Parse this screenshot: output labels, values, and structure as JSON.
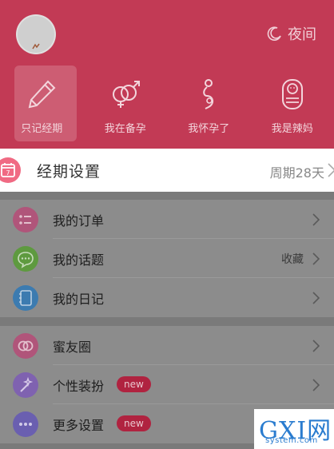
{
  "header": {
    "night_label": "夜间",
    "night_icon": "moon-icon",
    "modes": [
      {
        "label": "只记经期",
        "icon": "pen-icon",
        "active": true
      },
      {
        "label": "我在备孕",
        "icon": "gender-rings-icon",
        "active": false
      },
      {
        "label": "我怀孕了",
        "icon": "pregnant-icon",
        "active": false
      },
      {
        "label": "我是辣妈",
        "icon": "baby-icon",
        "active": false
      }
    ]
  },
  "period": {
    "title": "经期设置",
    "value": "周期28天",
    "icon": "calendar-icon",
    "calendar_day": "7"
  },
  "menu": {
    "orders": {
      "label": "我的订单",
      "icon": "list-icon"
    },
    "topics": {
      "label": "我的话题",
      "right": "收藏",
      "icon": "chat-bubble-icon"
    },
    "diary": {
      "label": "我的日记",
      "icon": "notebook-icon"
    },
    "friends": {
      "label": "蜜友圈",
      "icon": "heart-rings-icon"
    },
    "dressup": {
      "label": "个性装扮",
      "badge": "new",
      "icon": "magic-wand-icon"
    },
    "more": {
      "label": "更多设置",
      "badge": "new",
      "icon": "more-dots-icon"
    }
  },
  "watermark": {
    "main": "GXI网",
    "sub": "system.com"
  },
  "colors": {
    "brand": "#c23a55",
    "badge": "#b02340"
  }
}
